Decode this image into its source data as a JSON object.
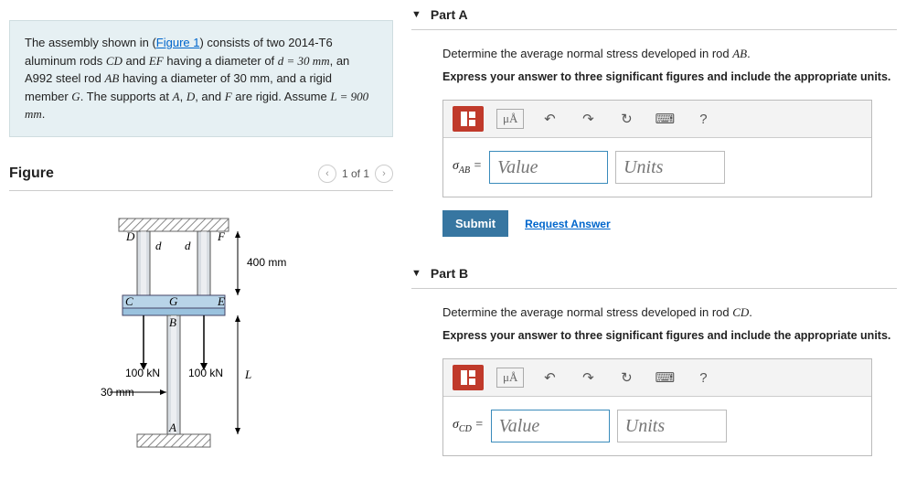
{
  "problem": {
    "intro_pre": "The assembly shown in (",
    "figure_link": "Figure 1",
    "intro_post": ") consists of two 2014-T6 aluminum rods ",
    "rod1": "CD",
    "and1": " and ",
    "rod2": "EF",
    "line2": " having a diameter of ",
    "dval": "d = 30 mm",
    "line3": ", an A992 steel rod ",
    "rod3": "AB",
    "line4": " having a diameter of 30 mm, and a rigid member ",
    "memG": "G",
    "line5": ". The supports at ",
    "ptA": "A",
    "c1": ", ",
    "ptD": "D",
    "c2": ", and ",
    "ptF": "F",
    "line6": " are rigid. Assume ",
    "Lval": "L = 900 mm",
    "period": "."
  },
  "figure": {
    "title": "Figure",
    "page": "1 of 1",
    "labels": {
      "D": "D",
      "F": "F",
      "C": "C",
      "G": "G",
      "E": "E",
      "B": "B",
      "A": "A",
      "d": "d",
      "dim400": "400 mm",
      "L": "L",
      "load": "100 kN",
      "dim30": "30 mm"
    }
  },
  "parts": {
    "A": {
      "header": "Part A",
      "question_pre": "Determine the average normal stress developed in rod ",
      "question_rod": "AB",
      "question_post": ".",
      "instruct": "Express your answer to three significant figures and include the appropriate units.",
      "symbol_pre": "σ",
      "symbol_sub": "AB",
      "eq": " =",
      "value_ph": "Value",
      "units_ph": "Units"
    },
    "B": {
      "header": "Part B",
      "question_pre": "Determine the average normal stress developed in rod ",
      "question_rod": "CD",
      "question_post": ".",
      "instruct": "Express your answer to three significant figures and include the appropriate units.",
      "symbol_pre": "σ",
      "symbol_sub": "CD",
      "eq": " =",
      "value_ph": "Value",
      "units_ph": "Units"
    }
  },
  "toolbar": {
    "units_sym": "μÅ",
    "undo": "↶",
    "redo": "↷",
    "reset": "↻",
    "keyboard": "⌨",
    "help": "?"
  },
  "actions": {
    "submit": "Submit",
    "request": "Request Answer"
  }
}
